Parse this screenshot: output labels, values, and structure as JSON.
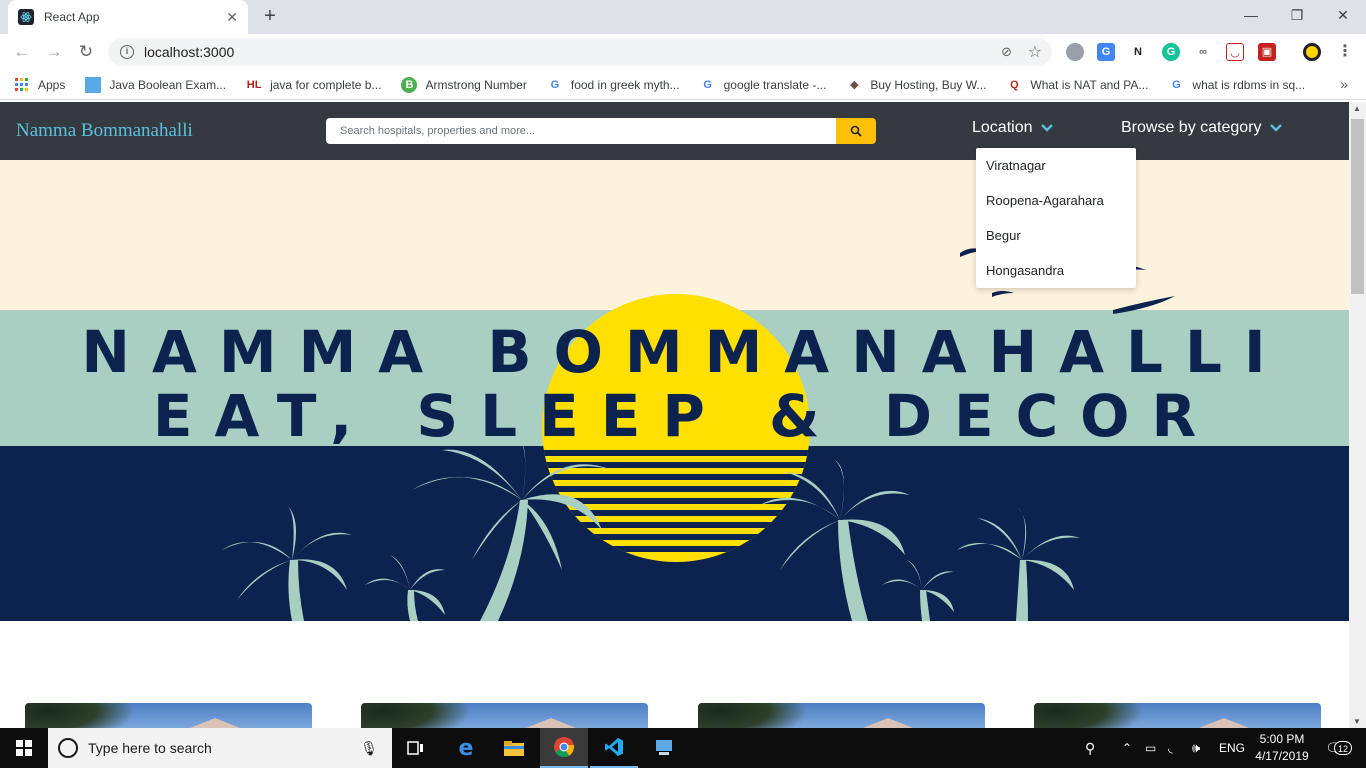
{
  "browser": {
    "tab_title": "React App",
    "new_tab": "+",
    "close_tab": "✕",
    "url": "localhost:3000",
    "window_controls": [
      "—",
      "❐",
      "✕"
    ]
  },
  "bookmarks": [
    {
      "label": "Apps",
      "icon": "apps-grid-icon"
    },
    {
      "label": "Java Boolean Exam...",
      "icon": "java-icon"
    },
    {
      "label": "java for complete b...",
      "icon": "hl-icon"
    },
    {
      "label": "Armstrong Number",
      "icon": "b-icon"
    },
    {
      "label": "food in greek myth...",
      "icon": "google-icon"
    },
    {
      "label": "google translate -...",
      "icon": "google-icon"
    },
    {
      "label": "Buy Hosting, Buy W...",
      "icon": "hosting-icon"
    },
    {
      "label": "What is NAT and PA...",
      "icon": "quora-icon"
    },
    {
      "label": "what is rdbms in sq...",
      "icon": "google-icon"
    }
  ],
  "app": {
    "brand": "Namma Bommanahalli",
    "search_placeholder": "Search hospitals, properties and more...",
    "nav": {
      "location": "Location",
      "category": "Browse by category"
    },
    "location_dropdown": [
      "Viratnagar",
      "Roopena-Agarahara",
      "Begur",
      "Hongasandra"
    ]
  },
  "hero": {
    "line1": "NAMMA BOMMANAHALLI",
    "line2": "EAT, SLEEP & DECOR",
    "colors": {
      "cream": "#fdf3dc",
      "mint": "#a8cfc1",
      "navy": "#0c2350",
      "sun": "#ffe000"
    }
  },
  "taskbar": {
    "search_text": "Type here to search",
    "language": "ENG",
    "time": "5:00 PM",
    "date": "4/17/2019",
    "notifications": "12"
  }
}
